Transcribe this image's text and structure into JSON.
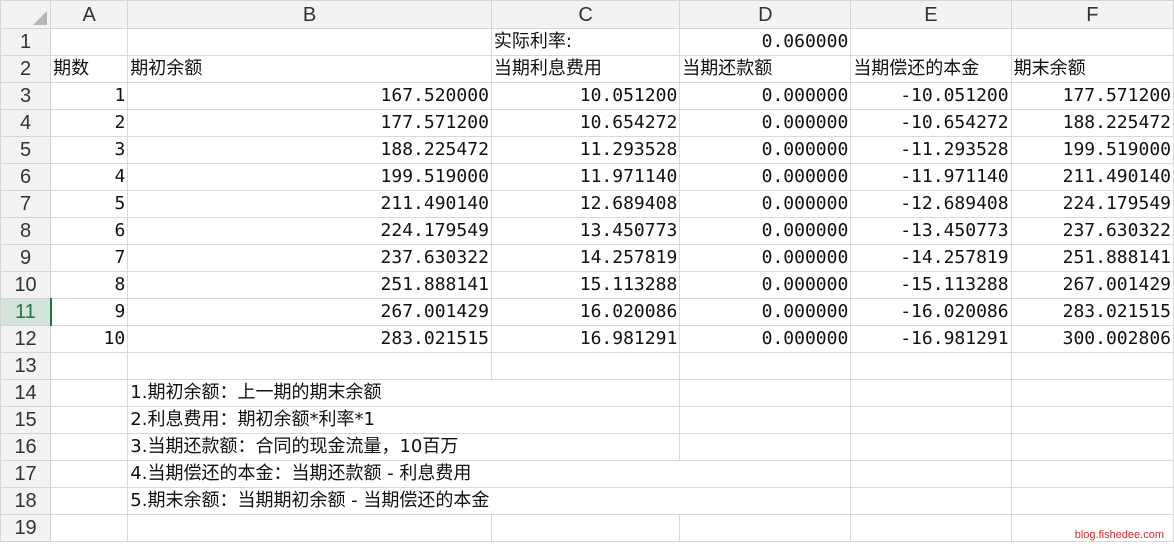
{
  "columns": [
    "A",
    "B",
    "C",
    "D",
    "E",
    "F"
  ],
  "row_numbers": [
    "1",
    "2",
    "3",
    "4",
    "5",
    "6",
    "7",
    "8",
    "9",
    "10",
    "11",
    "12",
    "13",
    "14",
    "15",
    "16",
    "17",
    "18",
    "19"
  ],
  "active_row": "11",
  "row1": {
    "c_label": "实际利率:",
    "d_value": "0.060000"
  },
  "headers": [
    "期数",
    "期初余额",
    "当期利息费用",
    "当期还款额",
    "当期偿还的本金",
    "期末余额"
  ],
  "rows": [
    [
      "1",
      "167.520000",
      "10.051200",
      "0.000000",
      "-10.051200",
      "177.571200"
    ],
    [
      "2",
      "177.571200",
      "10.654272",
      "0.000000",
      "-10.654272",
      "188.225472"
    ],
    [
      "3",
      "188.225472",
      "11.293528",
      "0.000000",
      "-11.293528",
      "199.519000"
    ],
    [
      "4",
      "199.519000",
      "11.971140",
      "0.000000",
      "-11.971140",
      "211.490140"
    ],
    [
      "5",
      "211.490140",
      "12.689408",
      "0.000000",
      "-12.689408",
      "224.179549"
    ],
    [
      "6",
      "224.179549",
      "13.450773",
      "0.000000",
      "-13.450773",
      "237.630322"
    ],
    [
      "7",
      "237.630322",
      "14.257819",
      "0.000000",
      "-14.257819",
      "251.888141"
    ],
    [
      "8",
      "251.888141",
      "15.113288",
      "0.000000",
      "-15.113288",
      "267.001429"
    ],
    [
      "9",
      "267.001429",
      "16.020086",
      "0.000000",
      "-16.020086",
      "283.021515"
    ],
    [
      "10",
      "283.021515",
      "16.981291",
      "0.000000",
      "-16.981291",
      "300.002806"
    ]
  ],
  "notes": [
    "1.期初余额：上一期的期末余额",
    "2.利息费用：期初余额*利率*1",
    "3.当期还款额：合同的现金流量，10百万",
    "4.当期偿还的本金：当期还款额 - 利息费用",
    "5.期末余额：当期期初余额 - 当期偿还的本金"
  ],
  "watermark": "blog.fishedee.com"
}
